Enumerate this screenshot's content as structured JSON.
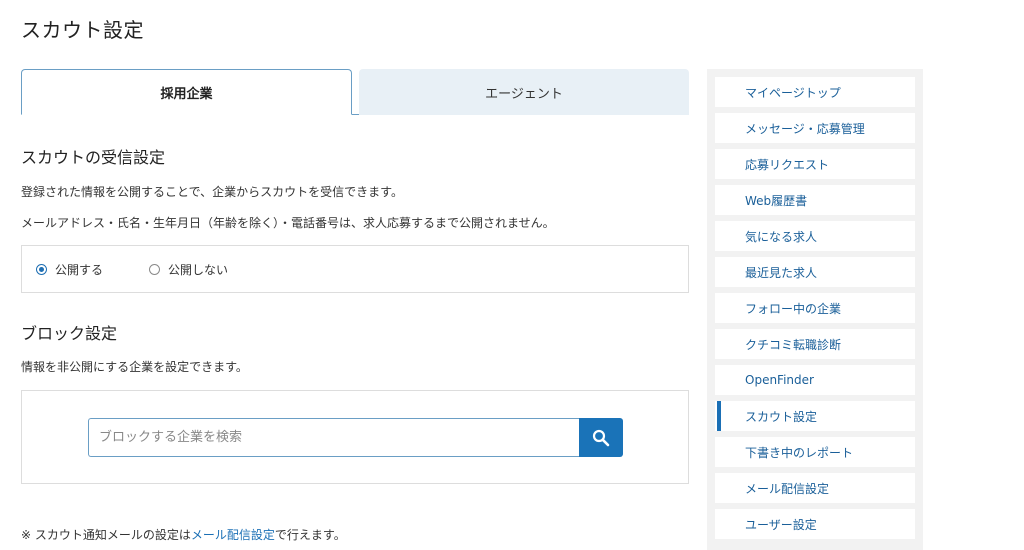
{
  "page": {
    "title": "スカウト設定"
  },
  "tabs": [
    {
      "label": "採用企業",
      "active": true
    },
    {
      "label": "エージェント",
      "active": false
    }
  ],
  "receive": {
    "title": "スカウトの受信設定",
    "desc1": "登録された情報を公開することで、企業からスカウトを受信できます。",
    "desc2": "メールアドレス・氏名・生年月日（年齢を除く）・電話番号は、求人応募するまで公開されません。",
    "options": [
      {
        "label": "公開する",
        "checked": true
      },
      {
        "label": "公開しない",
        "checked": false
      }
    ]
  },
  "block": {
    "title": "ブロック設定",
    "desc": "情報を非公開にする企業を設定できます。",
    "search_placeholder": "ブロックする企業を検索",
    "search_icon": "search-icon"
  },
  "note": {
    "prefix": "※ スカウト通知メールの設定は",
    "link": "メール配信設定",
    "suffix": "で行えます。"
  },
  "sidebar": {
    "items": [
      {
        "label": "マイページトップ",
        "active": false
      },
      {
        "label": "メッセージ・応募管理",
        "active": false
      },
      {
        "label": "応募リクエスト",
        "active": false
      },
      {
        "label": "Web履歴書",
        "active": false
      },
      {
        "label": "気になる求人",
        "active": false
      },
      {
        "label": "最近見た求人",
        "active": false
      },
      {
        "label": "フォロー中の企業",
        "active": false
      },
      {
        "label": "クチコミ転職診断",
        "active": false
      },
      {
        "label": "OpenFinder",
        "active": false
      },
      {
        "label": "スカウト設定",
        "active": true
      },
      {
        "label": "下書き中のレポート",
        "active": false
      },
      {
        "label": "メール配信設定",
        "active": false
      },
      {
        "label": "ユーザー設定",
        "active": false
      }
    ]
  },
  "colors": {
    "accent": "#1a73b8",
    "link": "#1a6fb5",
    "tab_inactive_bg": "#e8f0f6",
    "sidebar_bg": "#f2f2f2"
  }
}
